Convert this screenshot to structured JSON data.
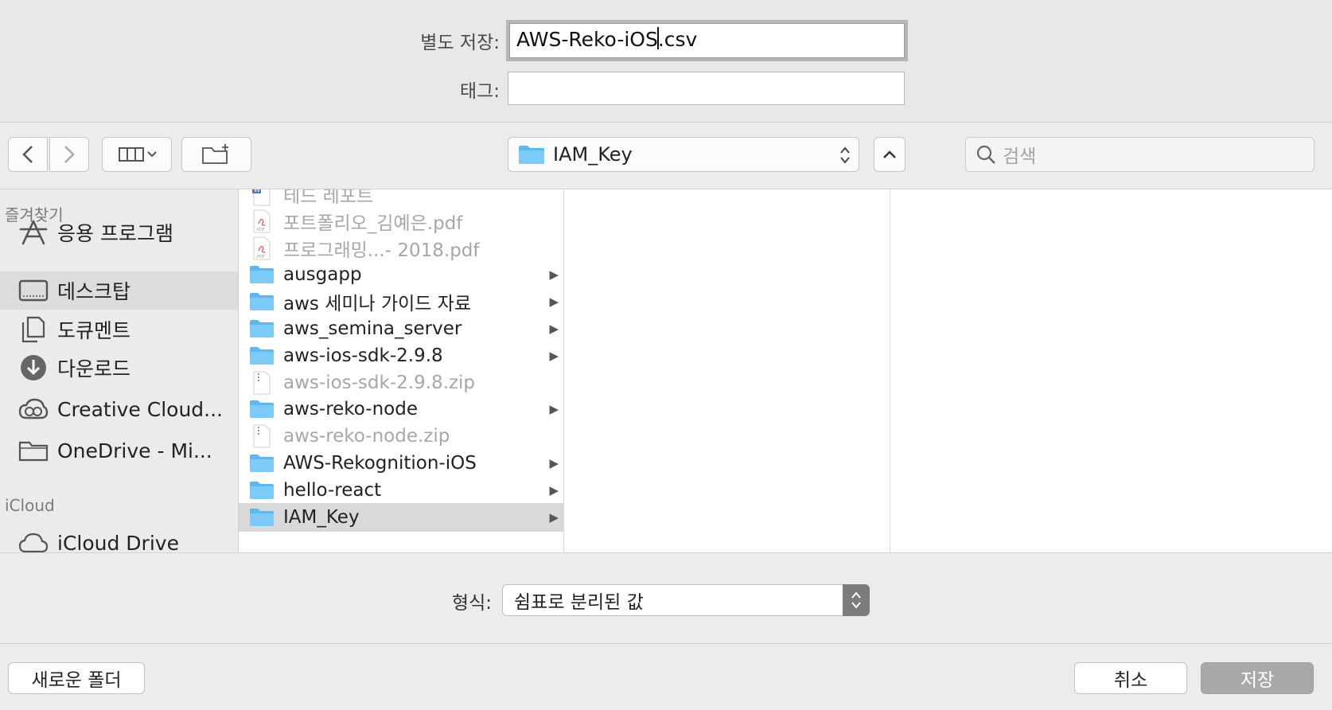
{
  "save_as": {
    "label": "별도 저장:",
    "value_before_caret": "AWS-Reko-iOS",
    "value_after_caret": ".csv"
  },
  "tags": {
    "label": "태그:",
    "value": ""
  },
  "toolbar": {
    "back_icon": "chevron-left-icon",
    "forward_icon": "chevron-right-icon",
    "view_icon": "column-view-icon",
    "new_folder_icon": "new-folder-icon",
    "path_folder": "IAM_Key",
    "expand_icon": "chevron-up-icon",
    "search_placeholder": "검색"
  },
  "sidebar": {
    "favorites_header": "즐겨찾기",
    "favorites": [
      {
        "label": "응용 프로그램",
        "icon": "applications-icon",
        "selected": false
      },
      {
        "label": "데스크탑",
        "icon": "desktop-icon",
        "selected": true
      },
      {
        "label": "도큐멘트",
        "icon": "documents-icon",
        "selected": false
      },
      {
        "label": "다운로드",
        "icon": "downloads-icon",
        "selected": false
      },
      {
        "label": "Creative Cloud...",
        "icon": "creative-cloud-icon",
        "selected": false
      },
      {
        "label": "OneDrive - Mi...",
        "icon": "folder-icon",
        "selected": false
      }
    ],
    "icloud_header": "iCloud",
    "icloud": [
      {
        "label": "iCloud Drive",
        "icon": "icloud-icon"
      }
    ]
  },
  "files": [
    {
      "name": "테드 레포트",
      "type": "word",
      "dim": true
    },
    {
      "name": "포트폴리오_김예은.pdf",
      "type": "pdf",
      "dim": true
    },
    {
      "name": "프로그래밍...- 2018.pdf",
      "type": "pdf",
      "dim": true
    },
    {
      "name": "ausgapp",
      "type": "folder",
      "dim": false
    },
    {
      "name": "aws 세미나 가이드 자료",
      "type": "folder",
      "dim": false
    },
    {
      "name": "aws_semina_server",
      "type": "folder",
      "dim": false
    },
    {
      "name": "aws-ios-sdk-2.9.8",
      "type": "folder",
      "dim": false
    },
    {
      "name": "aws-ios-sdk-2.9.8.zip",
      "type": "zip",
      "dim": true
    },
    {
      "name": "aws-reko-node",
      "type": "folder",
      "dim": false
    },
    {
      "name": "aws-reko-node.zip",
      "type": "zip",
      "dim": true
    },
    {
      "name": "AWS-Rekognition-iOS",
      "type": "folder",
      "dim": false
    },
    {
      "name": "hello-react",
      "type": "folder",
      "dim": false
    },
    {
      "name": "IAM_Key",
      "type": "folder",
      "dim": false,
      "selected": true
    }
  ],
  "format": {
    "label": "형식:",
    "value": "쉼표로 분리된 값"
  },
  "buttons": {
    "new_folder": "새로운 폴더",
    "cancel": "취소",
    "save": "저장"
  },
  "colors": {
    "folder": "#5cb8f0",
    "selection": "#d9d9d9"
  }
}
